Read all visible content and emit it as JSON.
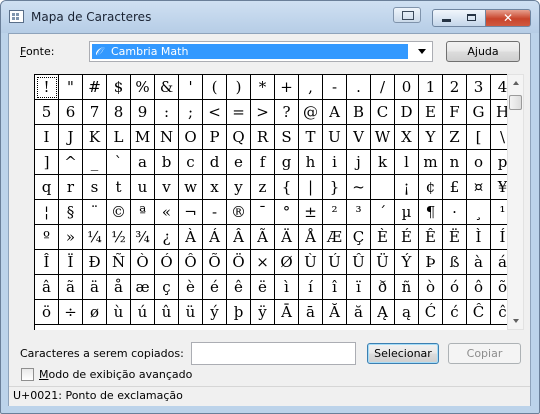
{
  "window": {
    "title": "Mapa de Caracteres"
  },
  "font": {
    "label_underlined": "F",
    "label_rest": "onte:",
    "selected": "Cambria Math"
  },
  "buttons": {
    "help_label": "Ajuda",
    "select_label": "Selecionar",
    "copy_label": "Copiar"
  },
  "copy": {
    "label": "Caracteres a serem copiados:",
    "value": ""
  },
  "advanced": {
    "label_underlined": "M",
    "label_rest": "odo de exibição avançado",
    "checked": false
  },
  "status": {
    "text": "U+0021: Ponto de exclamação"
  },
  "grid": {
    "columns": 20,
    "selected_index": 0,
    "characters": [
      "!",
      "\"",
      "#",
      "$",
      "%",
      "&",
      "'",
      "(",
      ")",
      "*",
      "+",
      ",",
      "-",
      ".",
      "/",
      "0",
      "1",
      "2",
      "3",
      "4",
      "5",
      "6",
      "7",
      "8",
      "9",
      ":",
      ";",
      "<",
      "=",
      ">",
      "?",
      "@",
      "A",
      "B",
      "C",
      "D",
      "E",
      "F",
      "G",
      "H",
      "I",
      "J",
      "K",
      "L",
      "M",
      "N",
      "O",
      "P",
      "Q",
      "R",
      "S",
      "T",
      "U",
      "V",
      "W",
      "X",
      "Y",
      "Z",
      "[",
      "\\",
      "]",
      "^",
      "_",
      "`",
      "a",
      "b",
      "c",
      "d",
      "e",
      "f",
      "g",
      "h",
      "i",
      "j",
      "k",
      "l",
      "m",
      "n",
      "o",
      "p",
      "q",
      "r",
      "s",
      "t",
      "u",
      "v",
      "w",
      "x",
      "y",
      "z",
      "{",
      "|",
      "}",
      "~",
      " ",
      "¡",
      "¢",
      "£",
      "¤",
      "¥",
      "¦",
      "§",
      "¨",
      "©",
      "ª",
      "«",
      "¬",
      "-",
      "®",
      "¯",
      "°",
      "±",
      "²",
      "³",
      "´",
      "µ",
      "¶",
      "·",
      "¸",
      "¹",
      "º",
      "»",
      "¼",
      "½",
      "¾",
      "¿",
      "À",
      "Á",
      "Â",
      "Ã",
      "Ä",
      "Å",
      "Æ",
      "Ç",
      "È",
      "É",
      "Ê",
      "Ë",
      "Ì",
      "Í",
      "Î",
      "Ï",
      "Ð",
      "Ñ",
      "Ò",
      "Ó",
      "Ô",
      "Õ",
      "Ö",
      "×",
      "Ø",
      "Ù",
      "Ú",
      "Û",
      "Ü",
      "Ý",
      "Þ",
      "ß",
      "à",
      "á",
      "â",
      "ã",
      "ä",
      "å",
      "æ",
      "ç",
      "è",
      "é",
      "ê",
      "ë",
      "ì",
      "í",
      "î",
      "ï",
      "ð",
      "ñ",
      "ò",
      "ó",
      "ô",
      "õ",
      "ö",
      "÷",
      "ø",
      "ù",
      "ú",
      "û",
      "ü",
      "ý",
      "þ",
      "ÿ",
      "Ā",
      "ā",
      "Ă",
      "ă",
      "Ą",
      "ą",
      "Ć",
      "ć",
      "Ĉ",
      "ĉ"
    ]
  }
}
